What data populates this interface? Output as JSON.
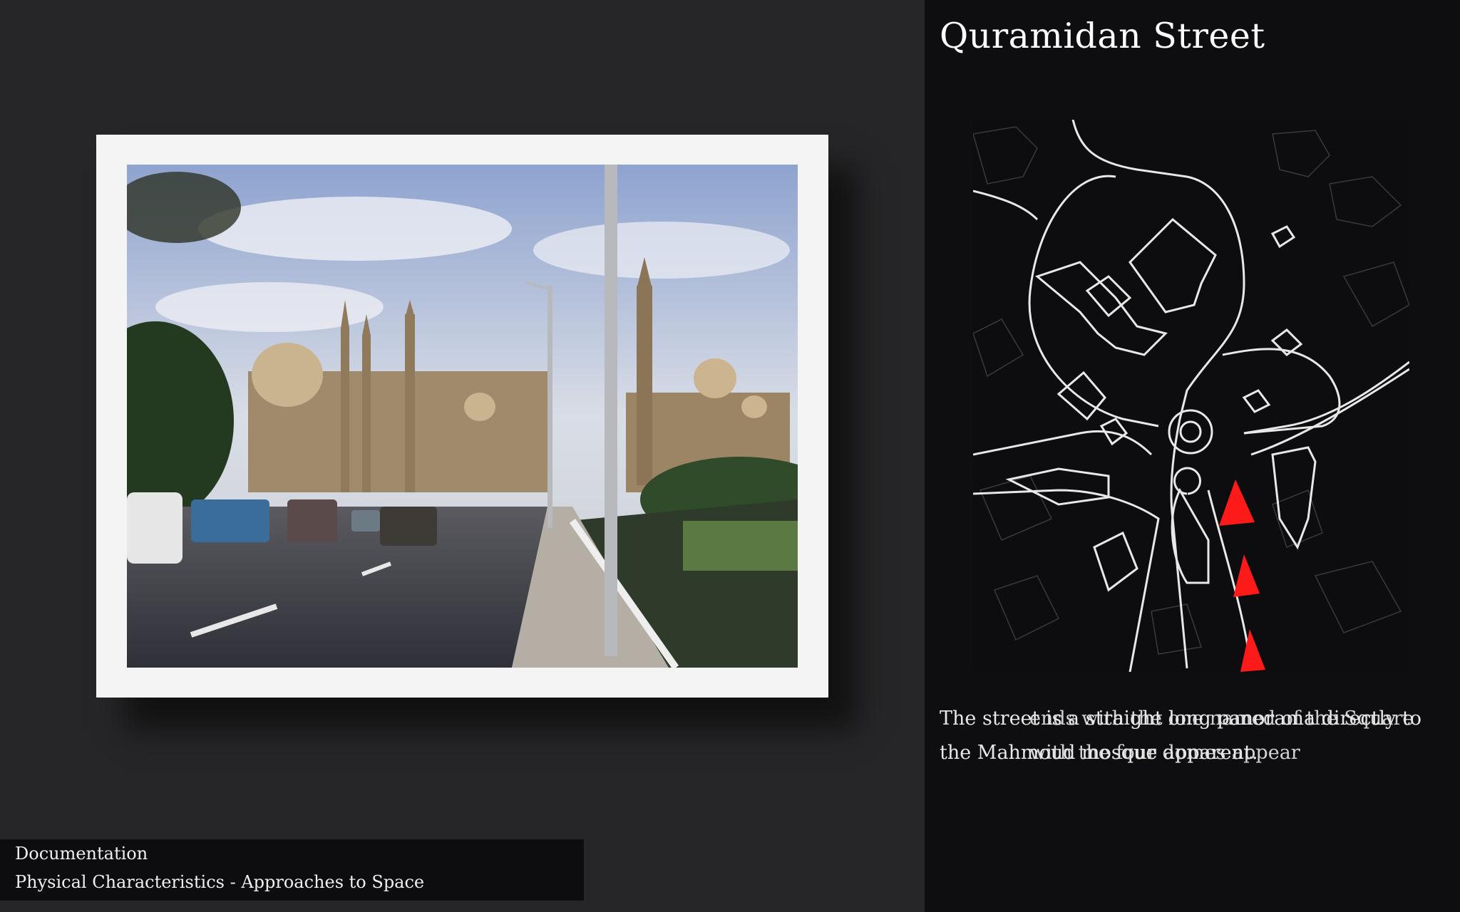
{
  "slide": {
    "title": "Quramidan Street",
    "caption_layer_1": "The street is a straight long panorama directly to the Mahmoud mosque apparent.",
    "caption_layer_2": "ends with the one named of the Square with the four domes appear",
    "footer": {
      "section": "Documentation",
      "subsection": "Physical Characteristics - Approaches to Space"
    }
  },
  "photo": {
    "subject": "street-view-with-mosques-and-minarets"
  },
  "map": {
    "subject": "line-map-of-street-and-square",
    "arrow_color": "#ff1a1a",
    "arrow_count": 3
  },
  "colors": {
    "page_bg": "#262628",
    "side_bg": "#0e0e10",
    "frame": "#f4f4f4",
    "accent": "#ff1a1a"
  }
}
